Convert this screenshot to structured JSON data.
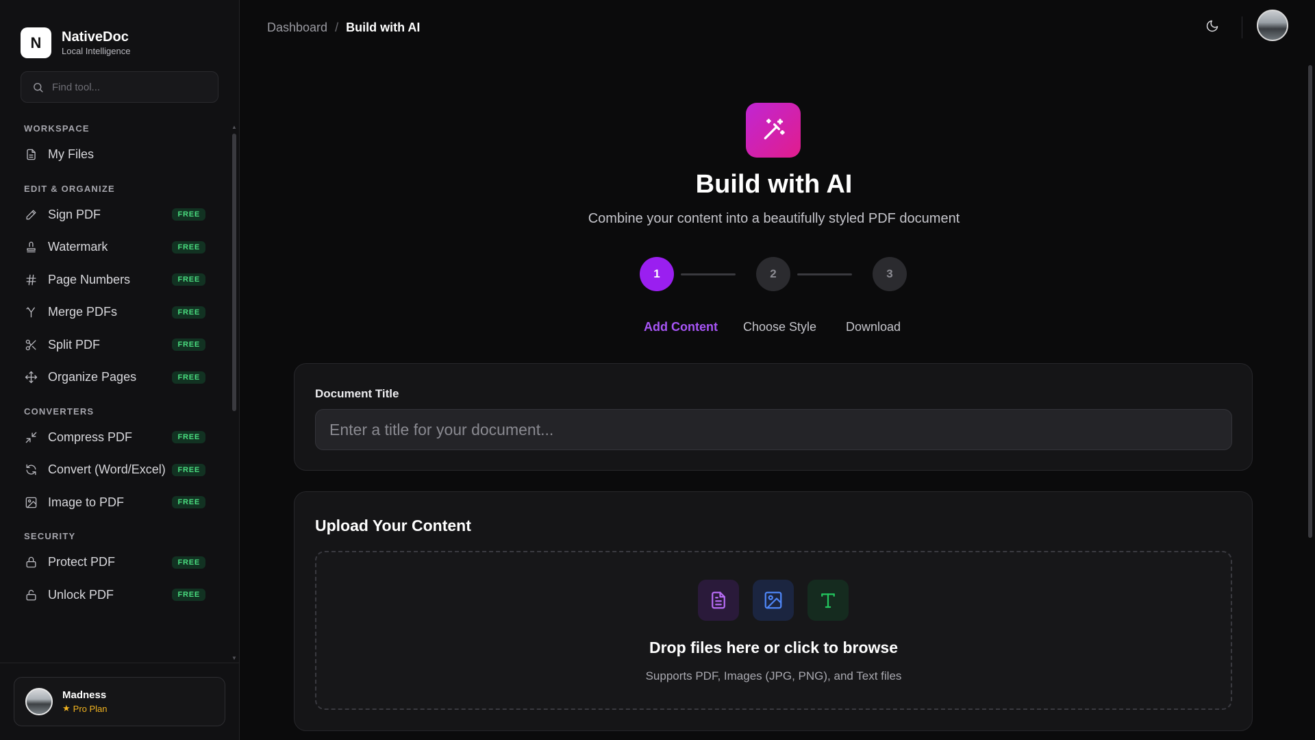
{
  "brand": {
    "logo_letter": "N",
    "name": "NativeDoc",
    "tagline": "Local Intelligence"
  },
  "search": {
    "placeholder": "Find tool..."
  },
  "sidebar": {
    "sections": [
      {
        "title": "WORKSPACE",
        "items": [
          {
            "label": "My Files",
            "icon": "file-icon",
            "badge": ""
          }
        ]
      },
      {
        "title": "EDIT & ORGANIZE",
        "items": [
          {
            "label": "Sign PDF",
            "icon": "pen-icon",
            "badge": "FREE"
          },
          {
            "label": "Watermark",
            "icon": "stamp-icon",
            "badge": "FREE"
          },
          {
            "label": "Page Numbers",
            "icon": "hash-icon",
            "badge": "FREE"
          },
          {
            "label": "Merge PDFs",
            "icon": "merge-icon",
            "badge": "FREE"
          },
          {
            "label": "Split PDF",
            "icon": "scissors-icon",
            "badge": "FREE"
          },
          {
            "label": "Organize Pages",
            "icon": "move-icon",
            "badge": "FREE"
          }
        ]
      },
      {
        "title": "CONVERTERS",
        "items": [
          {
            "label": "Compress PDF",
            "icon": "compress-icon",
            "badge": "FREE"
          },
          {
            "label": "Convert (Word/Excel)",
            "icon": "refresh-icon",
            "badge": "FREE"
          },
          {
            "label": "Image to PDF",
            "icon": "image-icon",
            "badge": "FREE"
          }
        ]
      },
      {
        "title": "SECURITY",
        "items": [
          {
            "label": "Protect PDF",
            "icon": "lock-icon",
            "badge": "FREE"
          },
          {
            "label": "Unlock PDF",
            "icon": "unlock-icon",
            "badge": "FREE"
          }
        ]
      }
    ]
  },
  "user": {
    "name": "Madness",
    "plan": "Pro Plan"
  },
  "breadcrumb": {
    "root": "Dashboard",
    "separator": "/",
    "current": "Build with AI"
  },
  "hero": {
    "title": "Build with AI",
    "subtitle": "Combine your content into a beautifully styled PDF document"
  },
  "steps": [
    {
      "number": "1",
      "label": "Add Content",
      "active": true
    },
    {
      "number": "2",
      "label": "Choose Style",
      "active": false
    },
    {
      "number": "3",
      "label": "Download",
      "active": false
    }
  ],
  "document_title": {
    "label": "Document Title",
    "placeholder": "Enter a title for your document...",
    "value": ""
  },
  "upload": {
    "heading": "Upload Your Content",
    "drop_title": "Drop files here or click to browse",
    "drop_subtitle": "Supports PDF, Images (JPG, PNG), and Text files"
  },
  "colors": {
    "accent": "#9a1ff0",
    "free_badge": "#4ade80",
    "plan": "#f2b420",
    "hero_gradient_start": "#c026d3",
    "hero_gradient_end": "#e11d8c"
  }
}
